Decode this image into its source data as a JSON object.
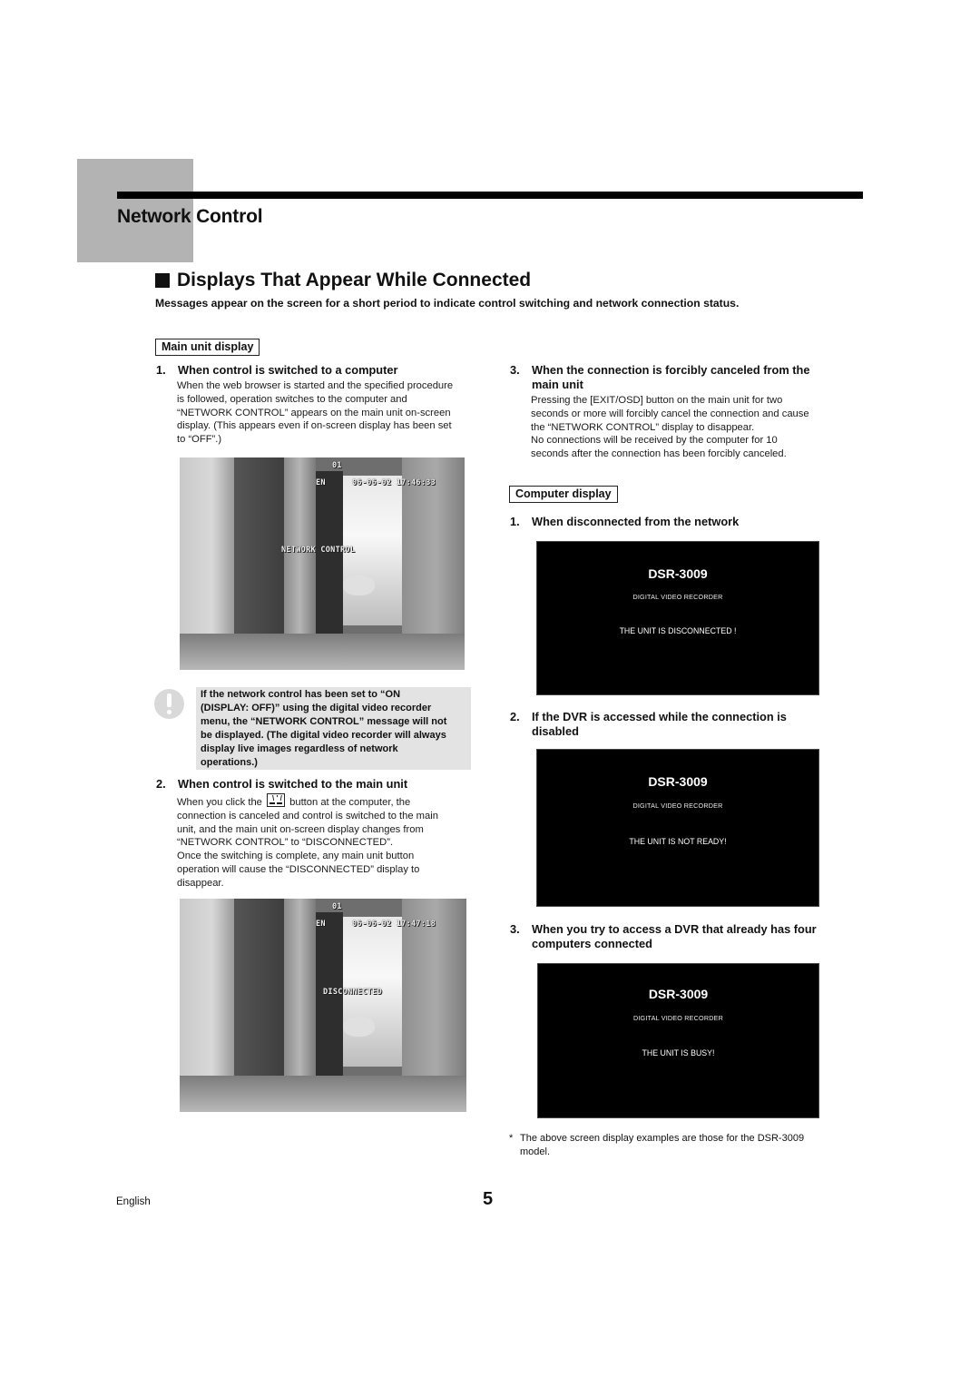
{
  "chapter": {
    "title": "Network Control"
  },
  "section": {
    "title": "Displays That Appear While Connected",
    "intro": "Messages appear on the screen for a short period to indicate control switching and network connection status."
  },
  "main_unit": {
    "label": "Main unit display",
    "items": [
      {
        "num": "1.",
        "heading": "When control is switched to a computer",
        "body": [
          "When the web browser is started and the specified procedure",
          "is followed, operation switches to the computer and",
          "“NETWORK CONTROL” appears on the main unit on-screen",
          "display. (This appears even if on-screen display has been set",
          "to “OFF”.)"
        ],
        "screenshot": {
          "channel": "01",
          "lang": "EN",
          "datetime": "06-06-02 17:46:33",
          "message": "NETWORK CONTROL"
        }
      },
      {
        "num": "2.",
        "heading": "When control is switched to the main unit",
        "body_before_icon": "When you click the",
        "body_after_icon": "button at the computer, the",
        "icon_name": "disconnect-button-icon",
        "body": [
          "connection is canceled and control is switched to the main",
          "unit, and the main unit on-screen display changes from",
          "“NETWORK CONTROL” to “DISCONNECTED”.",
          "Once the switching is complete, any main unit button",
          "operation will cause the “DISCONNECTED” display to",
          "disappear."
        ],
        "screenshot": {
          "channel": "01",
          "lang": "EN",
          "datetime": "06-06-02 17:47:18",
          "message": "DISCONNECTED"
        }
      },
      {
        "num": "3.",
        "heading_lines": [
          "When the connection is forcibly canceled from the",
          "main unit"
        ],
        "body": [
          "Pressing the [EXIT/OSD] button on the main unit for two",
          "seconds or more will forcibly cancel the connection and cause",
          "the “NETWORK CONTROL” display to disappear.",
          "No connections will be received by the computer for 10",
          "seconds after the connection has been forcibly canceled."
        ]
      }
    ],
    "caution": {
      "icon": "caution-icon",
      "lines": [
        "If the network control has been set to “ON",
        "(DISPLAY: OFF)” using the digital video recorder",
        "menu, the “NETWORK CONTROL” message will not",
        "be displayed. (The digital video recorder will always",
        "display live images regardless of network",
        "operations.)"
      ]
    }
  },
  "computer_display": {
    "label": "Computer display",
    "items": [
      {
        "num": "1.",
        "heading_lines": [
          "When disconnected from the network"
        ],
        "screen": {
          "model": "DSR-3009",
          "subtitle": "DIGITAL VIDEO RECORDER",
          "message": "THE UNIT IS DISCONNECTED !"
        }
      },
      {
        "num": "2.",
        "heading_lines": [
          "If the DVR is accessed while the connection is",
          "disabled"
        ],
        "screen": {
          "model": "DSR-3009",
          "subtitle": "DIGITAL VIDEO RECORDER",
          "message": "THE UNIT IS NOT READY!"
        }
      },
      {
        "num": "3.",
        "heading_lines": [
          "When you try to access a DVR that already has four",
          "computers connected"
        ],
        "screen": {
          "model": "DSR-3009",
          "subtitle": "DIGITAL VIDEO RECORDER",
          "message": "THE UNIT IS BUSY!"
        }
      }
    ],
    "footnote": {
      "mark": "*",
      "lines": [
        "The above screen display examples are those for the DSR-3009",
        "model."
      ]
    }
  },
  "footer": {
    "language": "English",
    "page": "5"
  },
  "colors": {
    "accent_gray": "#b3b3b3",
    "caution_bg": "#e3e3e3",
    "screen_bg": "#000000"
  }
}
